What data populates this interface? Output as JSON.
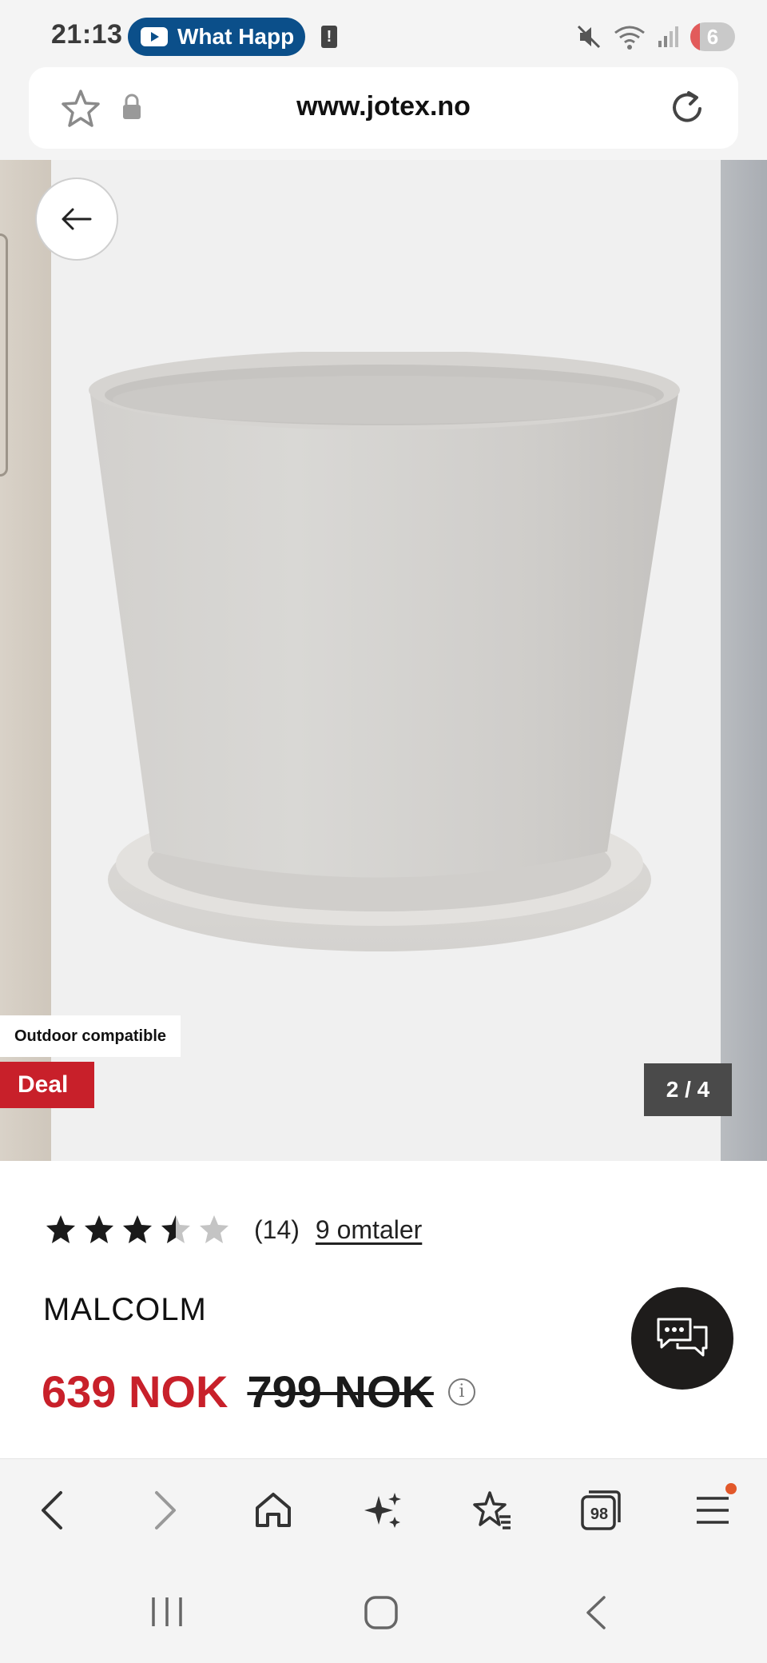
{
  "status_bar": {
    "time": "21:13",
    "media_pill_text": "What Happ",
    "alert_glyph": "!",
    "battery_level": "6",
    "icons": [
      "youtube-icon",
      "alert-icon",
      "mute-icon",
      "wifi-icon",
      "signal-icon",
      "battery-icon"
    ]
  },
  "url_bar": {
    "url": "www.jotex.no",
    "icons": [
      "star-icon",
      "lock-icon",
      "reload-icon"
    ]
  },
  "gallery": {
    "badge_outdoor": "Outdoor compatible",
    "badge_deal": "Deal",
    "counter": "2 / 4",
    "current_image": 2,
    "total_images": 4,
    "back_icon": "arrow-left-icon"
  },
  "product": {
    "rating_value": 3.5,
    "rating_max": 5,
    "rating_count": "(14)",
    "reviews_link": "9 omtaler",
    "name": "MALCOLM",
    "price_now": "639 NOK",
    "price_old": "799 NOK",
    "info_glyph": "i",
    "chat_icon": "chat-icon"
  },
  "toolbar": {
    "tabs_count": "98",
    "items": [
      "back-icon",
      "forward-icon",
      "home-icon",
      "ai-sparkle-icon",
      "bookmarks-icon",
      "tabs-icon",
      "menu-icon"
    ]
  },
  "system_nav": {
    "items": [
      "recents-icon",
      "home-icon",
      "back-icon"
    ]
  },
  "colors": {
    "accent_red": "#c8202a",
    "media_pill": "#0b4f8a",
    "chat_button": "#1e1c1b",
    "notification_dot": "#e2582a"
  }
}
